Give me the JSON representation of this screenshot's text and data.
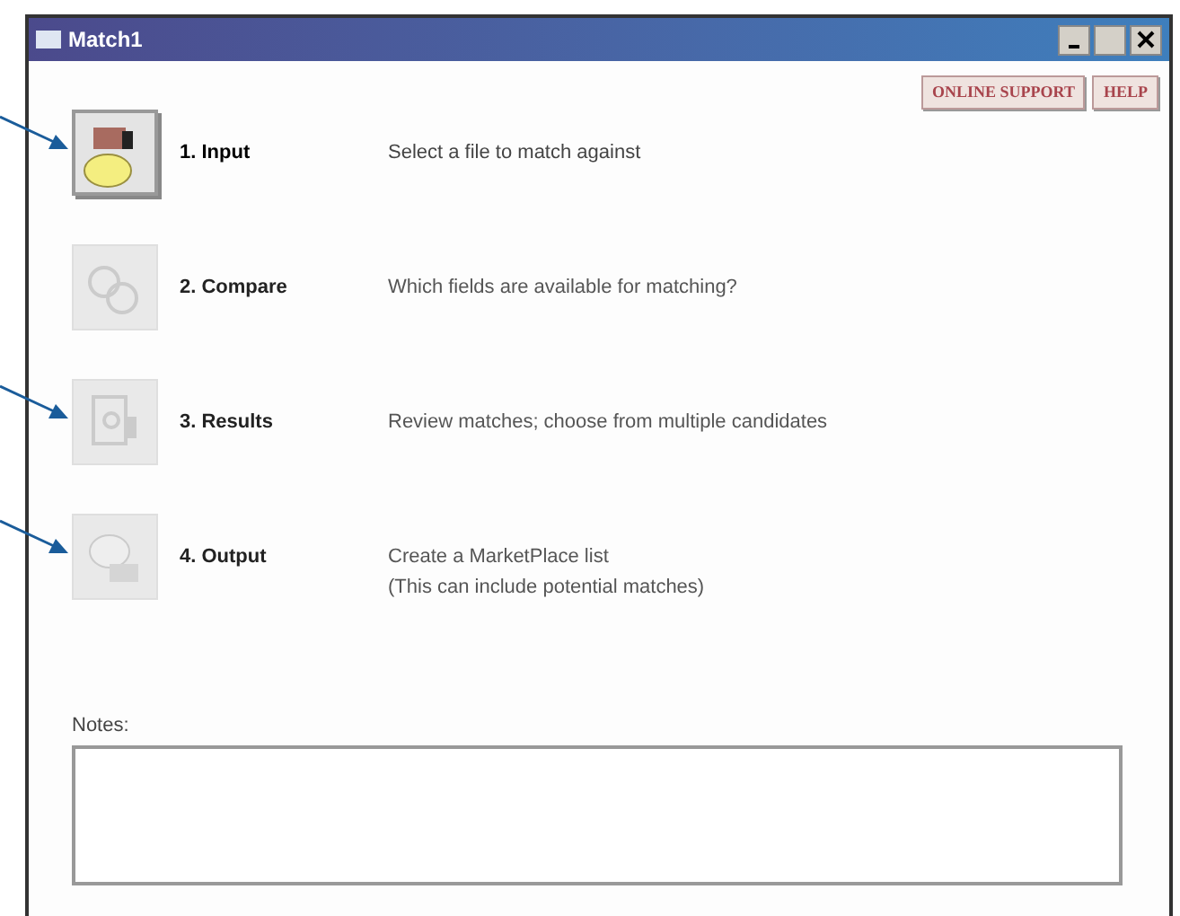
{
  "window": {
    "title": "Match1"
  },
  "header_buttons": [
    "ONLINE SUPPORT",
    "HELP"
  ],
  "steps": [
    {
      "kind": "input",
      "label": "1. Input",
      "description": [
        "Select a file to match against"
      ],
      "enabled": true,
      "callout": true
    },
    {
      "kind": "compare",
      "label": "2. Compare",
      "description": [
        "Which fields are available for matching?"
      ],
      "enabled": false,
      "callout": false
    },
    {
      "kind": "results",
      "label": "3. Results",
      "description": [
        "Review matches; choose from multiple candidates"
      ],
      "enabled": false,
      "callout": true
    },
    {
      "kind": "output",
      "label": "4. Output",
      "description": [
        "Create a MarketPlace list",
        "(This can include potential matches)"
      ],
      "enabled": false,
      "callout": true
    }
  ],
  "notes": {
    "label": "Notes:"
  }
}
